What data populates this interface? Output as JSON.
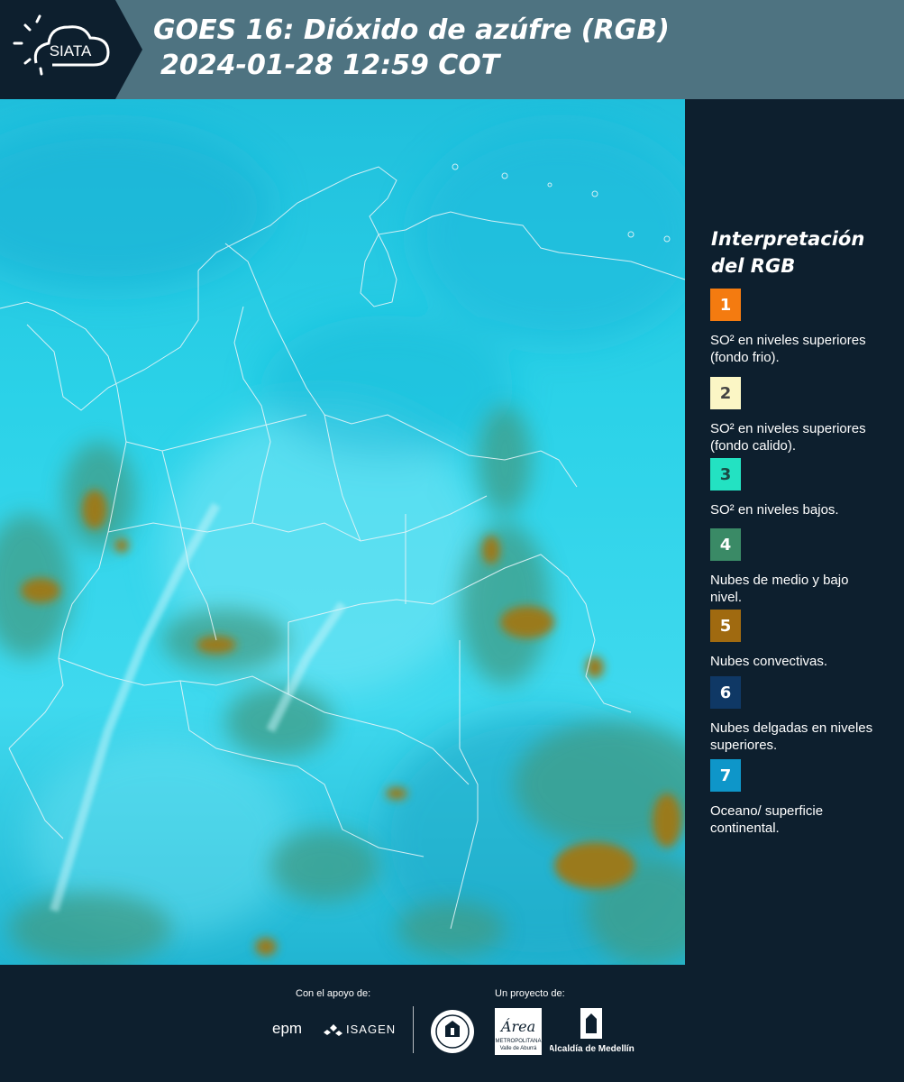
{
  "header": {
    "logo_text": "SIATA",
    "title_line1": "GOES 16: Dióxido de azúfre (RGB)",
    "title_line2": "2024-01-28 12:59 COT"
  },
  "legend": {
    "title": "Interpretación del RGB",
    "items": [
      {
        "number": "1",
        "label": "SO² en niveles superiores (fondo frio).",
        "color": "#f47b10",
        "text_color": "#ffffff"
      },
      {
        "number": "2",
        "label": "SO² en niveles superiores (fondo calido).",
        "color": "#fbf6c5",
        "text_color": "#444444"
      },
      {
        "number": "3",
        "label": "SO² en niveles bajos.",
        "color": "#23e2c2",
        "text_color": "#1a4a44"
      },
      {
        "number": "4",
        "label": "Nubes de medio y bajo nivel.",
        "color": "#3a8a66",
        "text_color": "#ffffff"
      },
      {
        "number": "5",
        "label": "Nubes convectivas.",
        "color": "#a06a10",
        "text_color": "#ffffff"
      },
      {
        "number": "6",
        "label": "Nubes delgadas en niveles superiores.",
        "color": "#0f3865",
        "text_color": "#ffffff"
      },
      {
        "number": "7",
        "label": "Oceano/ superficie continental.",
        "color": "#0e96c9",
        "text_color": "#ffffff"
      }
    ]
  },
  "footer": {
    "support_label": "Con el apoyo de:",
    "project_label": "Un proyecto de:",
    "sponsors": [
      "epm",
      "ISAGEN"
    ],
    "partners": [
      "METROPOLITANA",
      "Alcaldía de Medellín"
    ],
    "area_logo_text": "Área",
    "area_logo_subtext": "Valle de Aburrá"
  },
  "colors": {
    "header_bg": "#4e7381",
    "panel_bg": "#0d1f2e",
    "map_cyan": "#17c8e0",
    "boundary_line": "#e6f4f8"
  }
}
